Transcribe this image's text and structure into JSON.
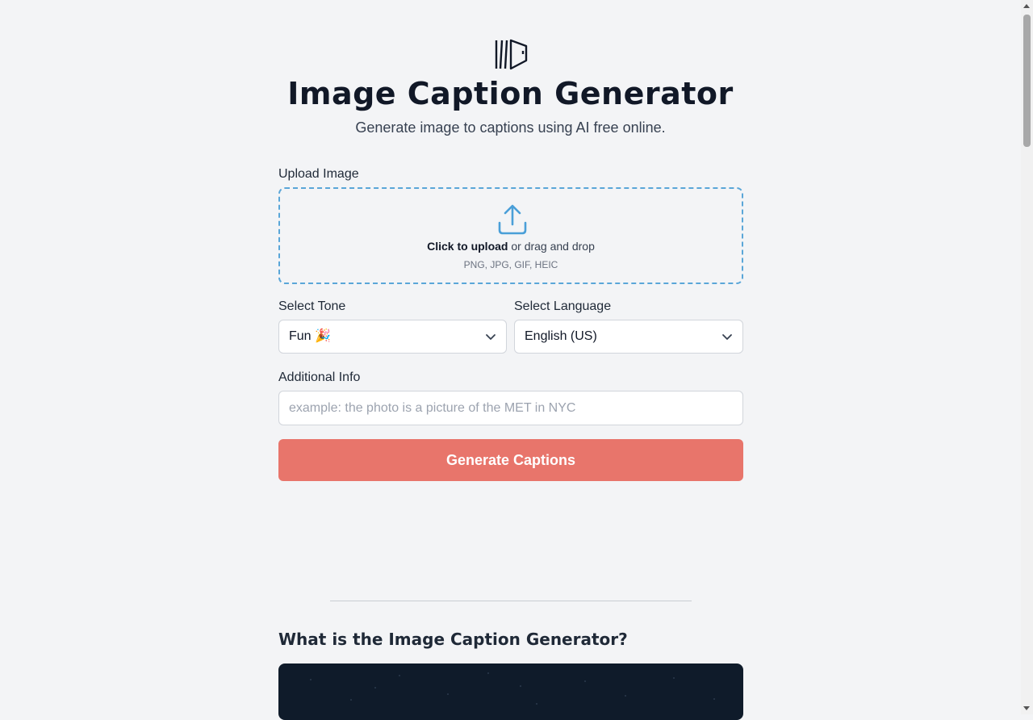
{
  "header": {
    "logo_icon": "captions-logo-icon",
    "title": "Image Caption Generator",
    "subtitle": "Generate image to captions using AI free online."
  },
  "upload": {
    "label": "Upload Image",
    "icon": "upload-icon",
    "click_text": "Click to upload",
    "drag_text": " or drag and drop",
    "formats": "PNG, JPG, GIF, HEIC"
  },
  "tone": {
    "label": "Select Tone",
    "value": "Fun 🎉"
  },
  "language": {
    "label": "Select Language",
    "value": "English (US)"
  },
  "additional": {
    "label": "Additional Info",
    "placeholder": "example: the photo is a picture of the MET in NYC",
    "value": ""
  },
  "generate_button": "Generate Captions",
  "section": {
    "title": "What is the Image Caption Generator?"
  },
  "colors": {
    "accent": "#e8756b",
    "upload_border": "#5aa6d8",
    "background": "#f3f4f6",
    "banner": "#0f1b2a"
  }
}
